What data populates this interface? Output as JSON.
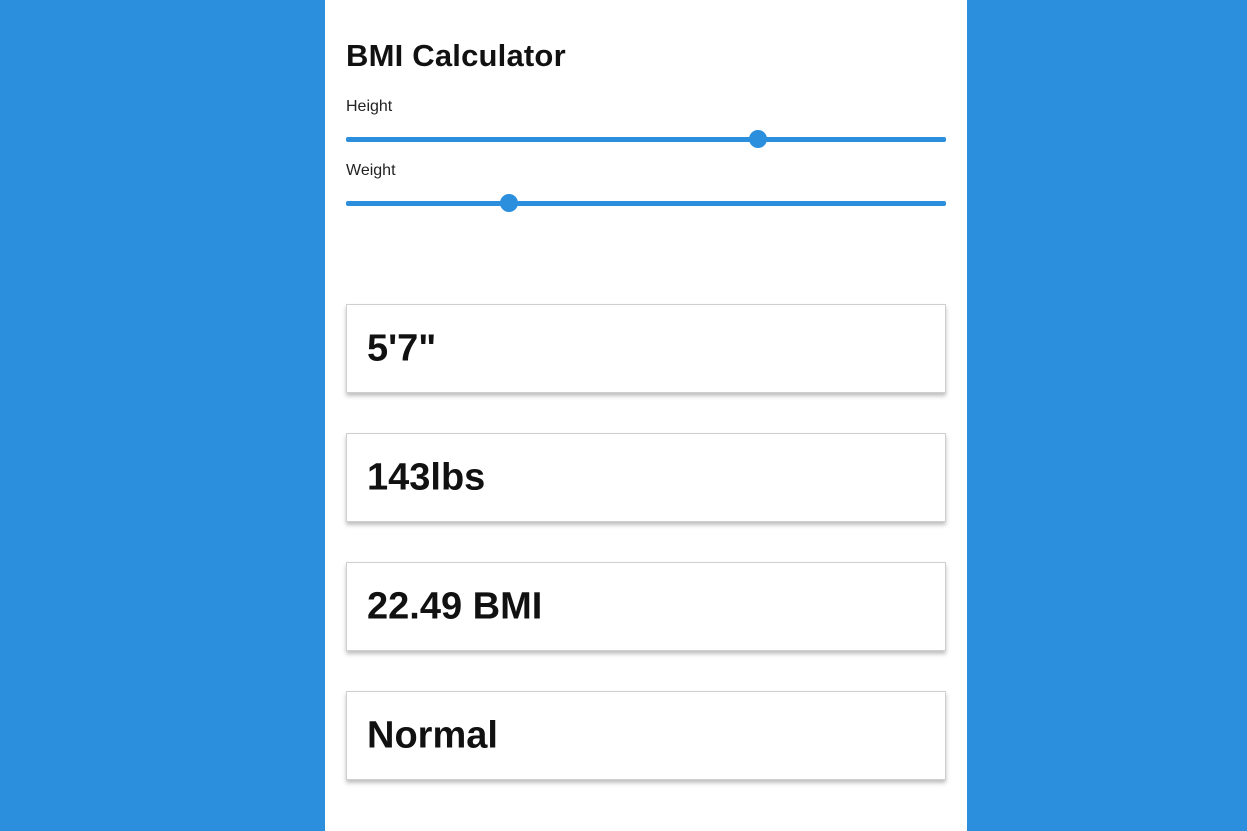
{
  "app": {
    "title": "BMI Calculator",
    "colors": {
      "background": "#2b8fde",
      "accent": "#2b8fde",
      "panel": "#ffffff"
    }
  },
  "sliders": {
    "height": {
      "label": "Height",
      "fraction": 0.687
    },
    "weight": {
      "label": "Weight",
      "fraction": 0.272
    }
  },
  "results": {
    "height_display": "5'7\"",
    "weight_display": "143lbs",
    "bmi_display": "22.49 BMI",
    "category": "Normal"
  }
}
